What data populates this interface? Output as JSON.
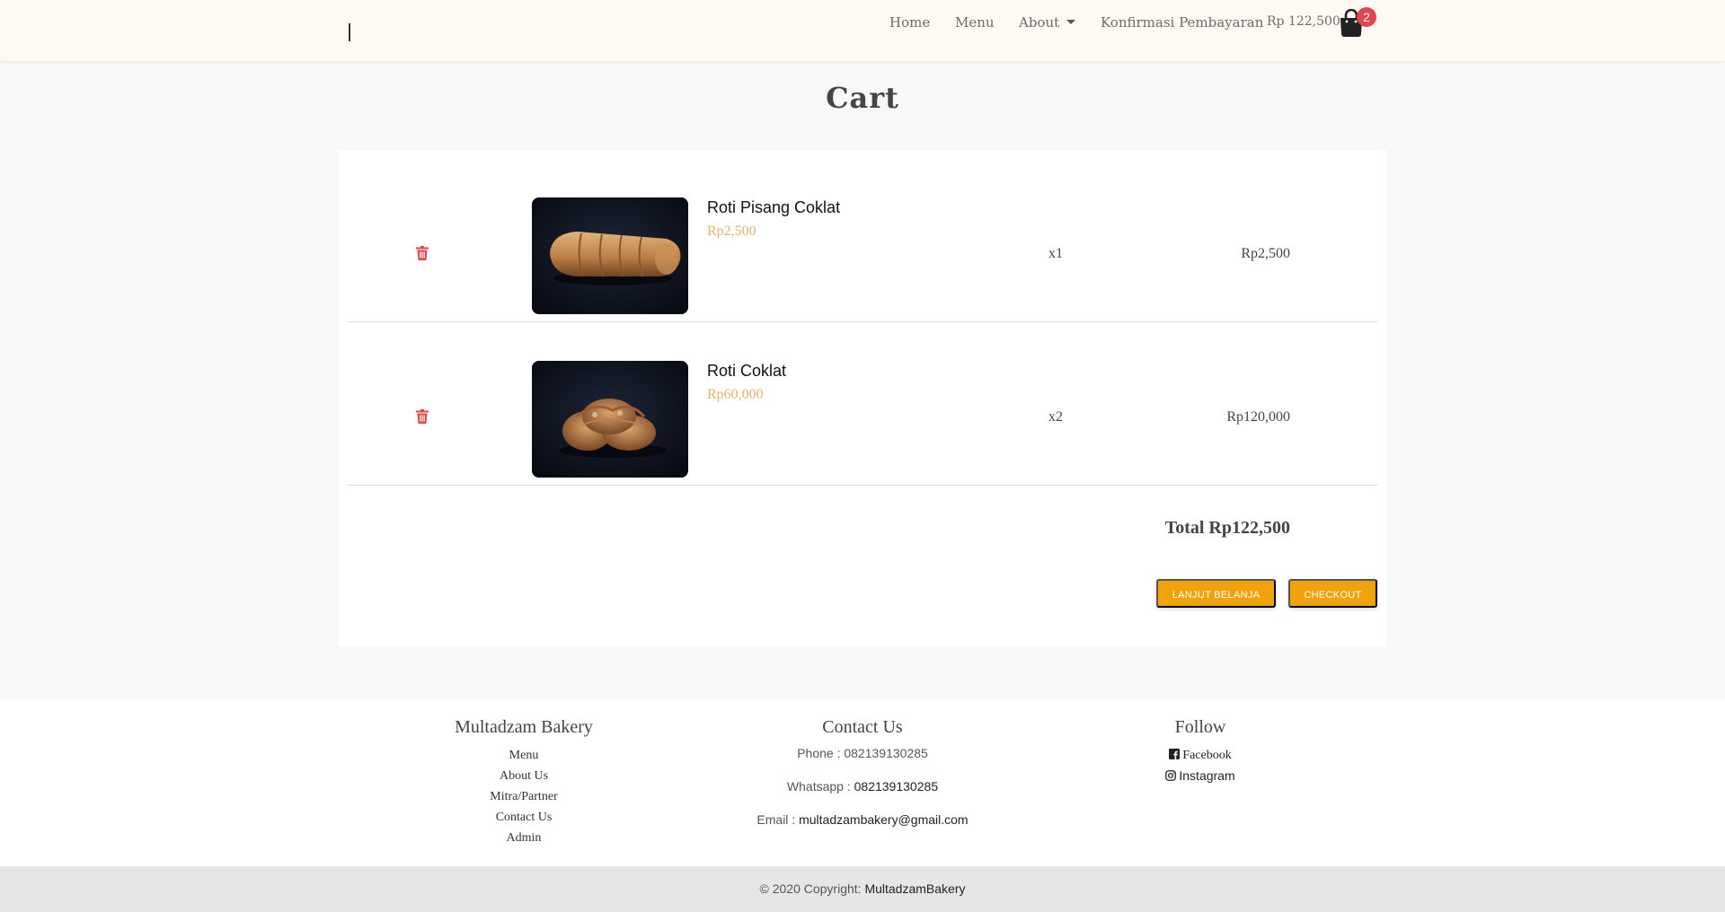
{
  "nav": {
    "home": "Home",
    "menu": "Menu",
    "about": "About",
    "konfirmasi": "Konfirmasi Pembayaran",
    "cart_amount": "Rp 122,500,-",
    "cart_count": "2"
  },
  "page": {
    "title": "Cart"
  },
  "cart": {
    "items": [
      {
        "name": "Roti Pisang Coklat",
        "price": "Rp2,500",
        "qty": "x1",
        "subtotal": "Rp2,500"
      },
      {
        "name": "Roti Coklat",
        "price": "Rp60,000",
        "qty": "x2",
        "subtotal": "Rp120,000"
      }
    ],
    "total": "Total Rp122,500",
    "continue_label": "LANJUT BELANJA",
    "checkout_label": "CHECKOUT"
  },
  "footer": {
    "col1": {
      "heading": "Multadzam Bakery",
      "links": [
        "Menu",
        "About Us",
        "Mitra/Partner",
        "Contact Us",
        "Admin"
      ]
    },
    "col2": {
      "heading": "Contact Us",
      "phone_label": "Phone : ",
      "phone": "082139130285",
      "whatsapp_label": "Whatsapp : ",
      "whatsapp": "082139130285",
      "email_label": "Email : ",
      "email": "multadzambakery@gmail.com"
    },
    "col3": {
      "heading": "Follow",
      "facebook": "Facebook",
      "instagram": "Instagram"
    }
  },
  "copyright": {
    "text": "© 2020 Copyright: ",
    "brand": "MultadzamBakery"
  },
  "colors": {
    "accent": "#f0a30a",
    "badge": "#e0464e",
    "price": "#e0b46d",
    "trash": "#e0464e"
  },
  "icons": {
    "cart": "shopping-bag-icon",
    "delete": "trash-icon",
    "facebook": "facebook-square-icon",
    "instagram": "instagram-icon"
  }
}
